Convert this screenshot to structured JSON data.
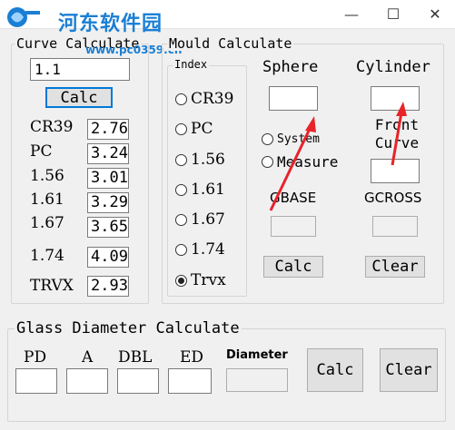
{
  "watermark": {
    "site_name": "河东软件园",
    "url": "www.pc0359.cn"
  },
  "window": {
    "minimize": "—",
    "maximize": "☐",
    "close": "✕"
  },
  "curve_calc": {
    "legend": "Curve Calculate",
    "input_value": "1.1",
    "calc_label": "Calc",
    "rows": [
      {
        "label": "CR39",
        "value": "2.76"
      },
      {
        "label": "PC",
        "value": "3.24"
      },
      {
        "label": "1.56",
        "value": "3.01"
      },
      {
        "label": "1.61",
        "value": "3.29"
      },
      {
        "label": "1.67",
        "value": "3.65"
      },
      {
        "label": "1.74",
        "value": "4.09"
      },
      {
        "label": "TRVX",
        "value": "2.93"
      }
    ]
  },
  "mould_calc": {
    "legend": "Mould Calculate",
    "index_legend": "Index",
    "index_options": [
      "CR39",
      "PC",
      "1.56",
      "1.61",
      "1.67",
      "1.74",
      "Trvx"
    ],
    "selected_index": "Trvx",
    "sphere_label": "Sphere",
    "cylinder_label": "Cylinder",
    "mode_options": [
      "System",
      "Measure"
    ],
    "front_curve_label": "Front Curve",
    "gbase_label": "GBASE",
    "gcross_label": "GCROSS",
    "calc_label": "Calc",
    "clear_label": "Clear"
  },
  "glass_calc": {
    "legend": "Glass Diameter Calculate",
    "pd_label": "PD",
    "a_label": "A",
    "dbl_label": "DBL",
    "ed_label": "ED",
    "diameter_label": "Diameter",
    "calc_label": "Calc",
    "clear_label": "Clear"
  },
  "annotations": {
    "arrow_color": "#e8232a"
  }
}
